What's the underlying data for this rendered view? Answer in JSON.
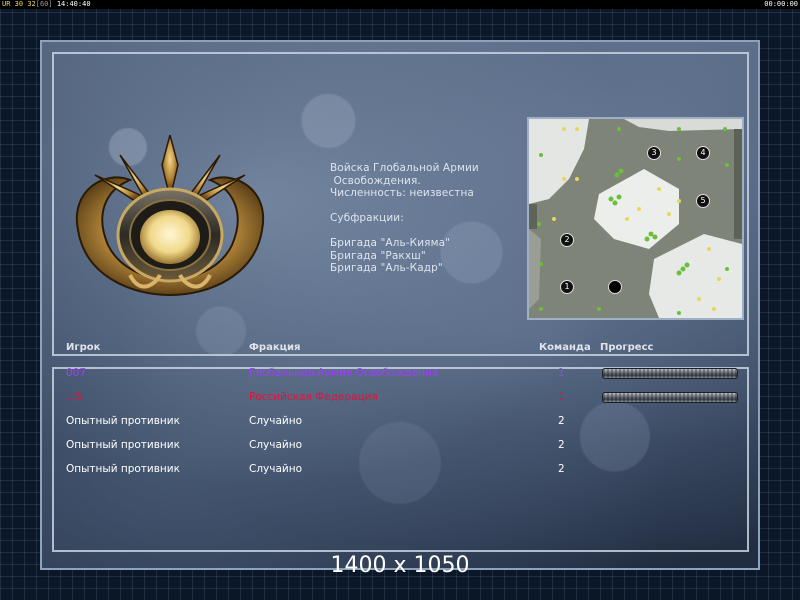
{
  "topbar": {
    "left_prefix": "UR",
    "left_a": "30",
    "left_b": "32",
    "left_fps": "[60]",
    "left_time": "14:40:40",
    "right_time": "00:00:00"
  },
  "faction_info": {
    "line1": "Войска Глобальной Армии",
    "line2": " Освобождения.",
    "line3": "Численность: неизвестна",
    "subfactions_label": "Субфракции:",
    "subfactions": [
      "Бригада \"Аль-Кияма\"",
      "Бригада \"Ракхш\"",
      "Бригада \"Аль-Кадр\""
    ]
  },
  "headers": {
    "player": "Игрок",
    "faction": "Фракция",
    "team": "Команда",
    "progress": "Прогресс"
  },
  "players": [
    {
      "name": "007",
      "faction": "Глобальная Армия Освобождения",
      "team": "1",
      "color": "#a23cff",
      "progress": 1.0
    },
    {
      "name": "LIS",
      "faction": "Российская Федерация",
      "team": "1",
      "color": "#e0143c",
      "progress": 1.0
    },
    {
      "name": "Опытный противник",
      "faction": "Случайно",
      "team": "2",
      "color": "#ffffff"
    },
    {
      "name": "Опытный противник",
      "faction": "Случайно",
      "team": "2",
      "color": "#ffffff"
    },
    {
      "name": "Опытный противник",
      "faction": "Случайно",
      "team": "2",
      "color": "#ffffff"
    }
  ],
  "minimap": {
    "start_positions": [
      "1",
      "2",
      "3",
      "4",
      "5",
      ""
    ]
  },
  "resolution_text": "1400 x 1050"
}
